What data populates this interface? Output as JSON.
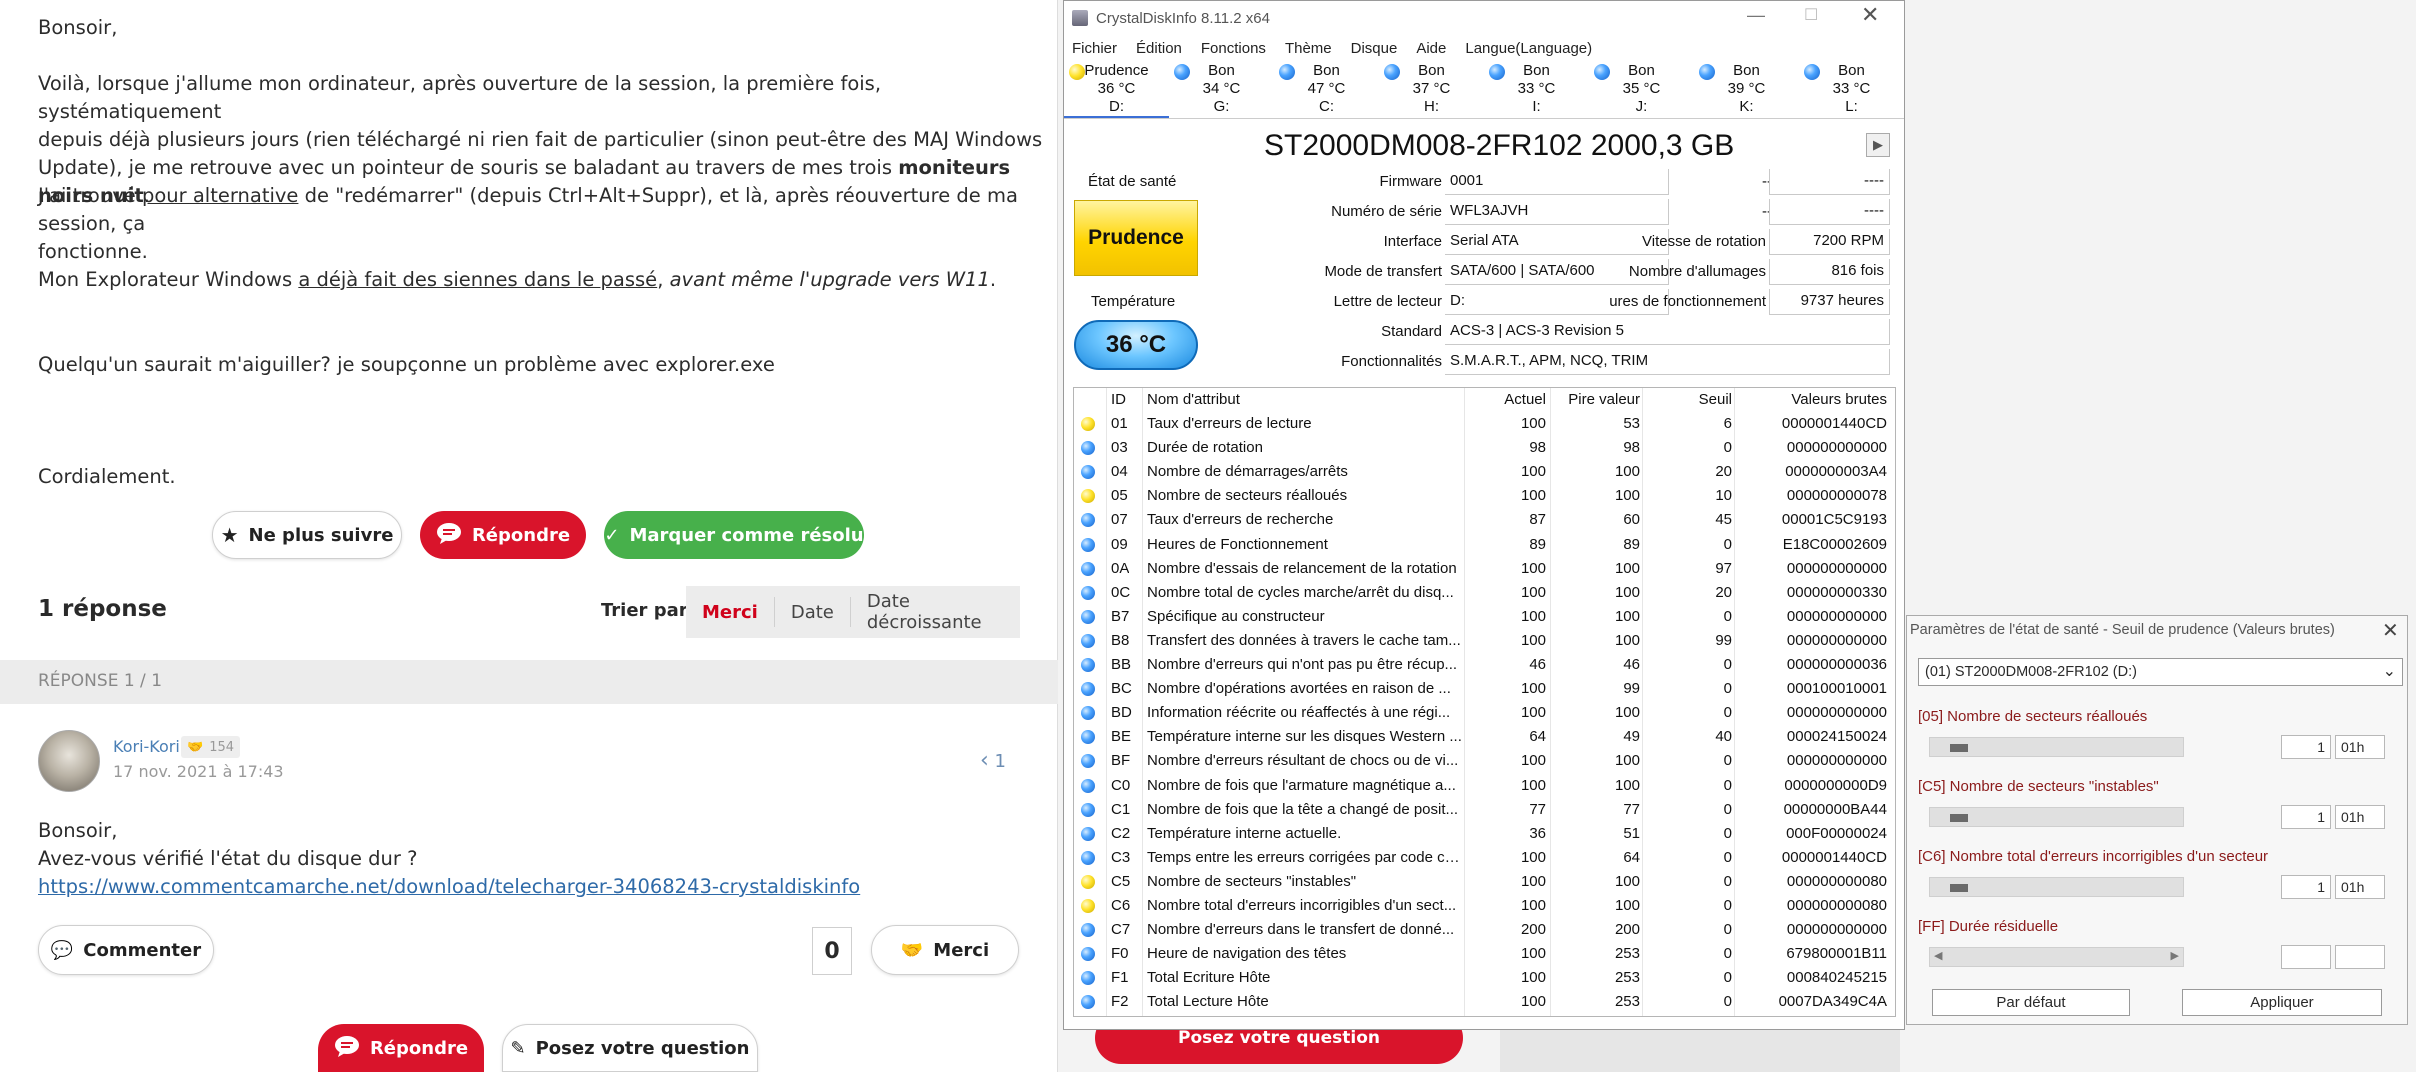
{
  "post": {
    "greeting": "Bonsoir,",
    "p1_a": "Voilà, lorsque j'allume mon ordinateur, après ouverture de la session, la première fois, systématiquement",
    "p1_b": "depuis déjà plusieurs jours (rien téléchargé ni rien fait de particulier (sinon peut-être des MAJ Windows",
    "p1_c": "Update), je me retrouve avec un pointeur de souris se baladant au travers de mes trois ",
    "p1_bold": "moniteurs noirs nuit",
    "p1_end": ".",
    "p2_a": "J'ai trouvé ",
    "p2_link": "pour alternative",
    "p2_b": " de \"redémarrer\" (depuis Ctrl+Alt+Suppr), et là, après réouverture de ma session, ça",
    "p2_c": "fonctionne.",
    "p3_a": "Mon Explorateur Windows ",
    "p3_link": "a déjà fait des siennes dans le passé",
    "p3_b": ", ",
    "p3_italic": "avant même l'upgrade vers W11",
    "p3_c": ".",
    "p4": "Quelqu'un saurait m'aiguiller? je soupçonne un problème avec explorer.exe",
    "sign": "Cordialement."
  },
  "actions": {
    "unfollow": "Ne plus suivre",
    "reply": "Répondre",
    "resolve": "Marquer comme résolu"
  },
  "answers": {
    "count": "1 réponse",
    "sort_label": "Trier par",
    "sort_options": [
      "Merci",
      "Date",
      "Date décroissante"
    ],
    "reply_header": "RÉPONSE 1 / 1",
    "author": "Kori-Kori",
    "author_score": "154",
    "date": "17 nov. 2021 à 17:43",
    "nav": "1",
    "body_1": "Bonsoir,",
    "body_2": "Avez-vous vérifié l'état du disque dur ?",
    "link": "https://www.commentcamarche.net/download/telecharger-34068243-crystaldiskinfo",
    "comment_btn": "Commenter",
    "thanks_count": "0",
    "thanks_btn": "Merci",
    "bottom_reply": "Répondre",
    "bottom_ask": "Posez votre question",
    "peek_btn": "Posez votre question"
  },
  "cdi": {
    "title": "CrystalDiskInfo 8.11.2 x64",
    "menu": [
      "Fichier",
      "Édition",
      "Fonctions",
      "Thème",
      "Disque",
      "Aide",
      "Langue(Language)"
    ],
    "drives": [
      {
        "status": "Prudence",
        "temp": "36 °C",
        "letter": "D:",
        "color": "yellow"
      },
      {
        "status": "Bon",
        "temp": "34 °C",
        "letter": "G:",
        "color": "blue"
      },
      {
        "status": "Bon",
        "temp": "47 °C",
        "letter": "C:",
        "color": "blue"
      },
      {
        "status": "Bon",
        "temp": "37 °C",
        "letter": "H:",
        "color": "blue"
      },
      {
        "status": "Bon",
        "temp": "33 °C",
        "letter": "I:",
        "color": "blue"
      },
      {
        "status": "Bon",
        "temp": "35 °C",
        "letter": "J:",
        "color": "blue"
      },
      {
        "status": "Bon",
        "temp": "39 °C",
        "letter": "K:",
        "color": "blue"
      },
      {
        "status": "Bon",
        "temp": "33 °C",
        "letter": "L:",
        "color": "blue"
      }
    ],
    "disk_title": "ST2000DM008-2FR102 2000,3 GB",
    "health_label": "État de santé",
    "health_value": "Prudence",
    "temp_label": "Température",
    "temp_value": "36 °C",
    "labels": {
      "firmware": "Firmware",
      "serial": "Numéro de série",
      "interface": "Interface",
      "transfer": "Mode de transfert",
      "letter": "Lettre de lecteur",
      "standard": "Standard",
      "features": "Fonctionnalités",
      "rotation": "Vitesse de rotation",
      "power_count": "Nombre d'allumages",
      "power_hours": "ures de fonctionnement",
      "dash": "----"
    },
    "values": {
      "firmware": "0001",
      "serial": "WFL3AJVH",
      "interface": "Serial ATA",
      "transfer": "SATA/600 | SATA/600",
      "letter": "D:",
      "standard": "ACS-3 | ACS-3 Revision 5",
      "features": "S.M.A.R.T., APM, NCQ, TRIM",
      "rotation": "7200 RPM",
      "power_count": "816 fois",
      "power_hours": "9737 heures",
      "dash": "----"
    },
    "columns": [
      "ID",
      "Nom d'attribut",
      "Actuel",
      "Pire valeur",
      "Seuil",
      "Valeurs brutes"
    ],
    "attributes": [
      {
        "dot": "yellow",
        "id": "01",
        "name": "Taux d'erreurs de lecture",
        "cur": "100",
        "worst": "53",
        "thr": "6",
        "raw": "0000001440CD"
      },
      {
        "dot": "blue",
        "id": "03",
        "name": "Durée de rotation",
        "cur": "98",
        "worst": "98",
        "thr": "0",
        "raw": "000000000000"
      },
      {
        "dot": "blue",
        "id": "04",
        "name": "Nombre de démarrages/arrêts",
        "cur": "100",
        "worst": "100",
        "thr": "20",
        "raw": "0000000003A4"
      },
      {
        "dot": "yellow",
        "id": "05",
        "name": "Nombre de secteurs réalloués",
        "cur": "100",
        "worst": "100",
        "thr": "10",
        "raw": "000000000078"
      },
      {
        "dot": "blue",
        "id": "07",
        "name": "Taux d'erreurs de recherche",
        "cur": "87",
        "worst": "60",
        "thr": "45",
        "raw": "00001C5C9193"
      },
      {
        "dot": "blue",
        "id": "09",
        "name": "Heures de Fonctionnement",
        "cur": "89",
        "worst": "89",
        "thr": "0",
        "raw": "E18C00002609"
      },
      {
        "dot": "blue",
        "id": "0A",
        "name": "Nombre d'essais de relancement de la rotation",
        "cur": "100",
        "worst": "100",
        "thr": "97",
        "raw": "000000000000"
      },
      {
        "dot": "blue",
        "id": "0C",
        "name": "Nombre total de cycles marche/arrêt du disq...",
        "cur": "100",
        "worst": "100",
        "thr": "20",
        "raw": "000000000330"
      },
      {
        "dot": "blue",
        "id": "B7",
        "name": "Spécifique au constructeur",
        "cur": "100",
        "worst": "100",
        "thr": "0",
        "raw": "000000000000"
      },
      {
        "dot": "blue",
        "id": "B8",
        "name": "Transfert des données à travers le cache tam...",
        "cur": "100",
        "worst": "100",
        "thr": "99",
        "raw": "000000000000"
      },
      {
        "dot": "blue",
        "id": "BB",
        "name": "Nombre d'erreurs qui n'ont pas pu être récup...",
        "cur": "46",
        "worst": "46",
        "thr": "0",
        "raw": "000000000036"
      },
      {
        "dot": "blue",
        "id": "BC",
        "name": "Nombre d'opérations avortées en raison de ...",
        "cur": "100",
        "worst": "99",
        "thr": "0",
        "raw": "000100010001"
      },
      {
        "dot": "blue",
        "id": "BD",
        "name": "Information réécrite ou réaffectés à une régi...",
        "cur": "100",
        "worst": "100",
        "thr": "0",
        "raw": "000000000000"
      },
      {
        "dot": "blue",
        "id": "BE",
        "name": "Température interne sur les disques Western ...",
        "cur": "64",
        "worst": "49",
        "thr": "40",
        "raw": "000024150024"
      },
      {
        "dot": "blue",
        "id": "BF",
        "name": "Nombre d'erreurs résultant de chocs ou de vi...",
        "cur": "100",
        "worst": "100",
        "thr": "0",
        "raw": "000000000000"
      },
      {
        "dot": "blue",
        "id": "C0",
        "name": "Nombre de fois que l'armature magnétique a...",
        "cur": "100",
        "worst": "100",
        "thr": "0",
        "raw": "0000000000D9"
      },
      {
        "dot": "blue",
        "id": "C1",
        "name": "Nombre de fois que la tête a changé de posit...",
        "cur": "77",
        "worst": "77",
        "thr": "0",
        "raw": "00000000BA44"
      },
      {
        "dot": "blue",
        "id": "C2",
        "name": "Température interne actuelle.",
        "cur": "36",
        "worst": "51",
        "thr": "0",
        "raw": "000F00000024"
      },
      {
        "dot": "blue",
        "id": "C3",
        "name": "Temps entre les erreurs corrigées par code co...",
        "cur": "100",
        "worst": "64",
        "thr": "0",
        "raw": "0000001440CD"
      },
      {
        "dot": "yellow",
        "id": "C5",
        "name": "Nombre de secteurs \"instables\"",
        "cur": "100",
        "worst": "100",
        "thr": "0",
        "raw": "000000000080"
      },
      {
        "dot": "yellow",
        "id": "C6",
        "name": "Nombre total d'erreurs incorrigibles d'un sect...",
        "cur": "100",
        "worst": "100",
        "thr": "0",
        "raw": "000000000080"
      },
      {
        "dot": "blue",
        "id": "C7",
        "name": "Nombre d'erreurs dans le transfert de donné...",
        "cur": "200",
        "worst": "200",
        "thr": "0",
        "raw": "000000000000"
      },
      {
        "dot": "blue",
        "id": "F0",
        "name": "Heure de navigation des têtes",
        "cur": "100",
        "worst": "253",
        "thr": "0",
        "raw": "679800001B11"
      },
      {
        "dot": "blue",
        "id": "F1",
        "name": "Total Ecriture Hôte",
        "cur": "100",
        "worst": "253",
        "thr": "0",
        "raw": "000840245215"
      },
      {
        "dot": "blue",
        "id": "F2",
        "name": "Total Lecture Hôte",
        "cur": "100",
        "worst": "253",
        "thr": "0",
        "raw": "0007DA349C4A"
      }
    ]
  },
  "dialog": {
    "title": "Paramètres de l'état de santé - Seuil de prudence (Valeurs brutes)",
    "drive_select": "(01) ST2000DM008-2FR102  (D:)",
    "sections": [
      {
        "label": "[05] Nombre de secteurs réalloués",
        "value": "1",
        "unit": "01h"
      },
      {
        "label": "[C5] Nombre de secteurs \"instables\"",
        "value": "1",
        "unit": "01h"
      },
      {
        "label": "[C6] Nombre total d'erreurs incorrigibles d'un secteur",
        "value": "1",
        "unit": "01h"
      },
      {
        "label": "[FF] Durée résiduelle",
        "value": "",
        "unit": ""
      }
    ],
    "default_btn": "Par défaut",
    "apply_btn": "Appliquer"
  },
  "colors": {
    "red": "#d9142b",
    "green": "#47b04b",
    "blue_dot": "#2a7de0",
    "yellow_dot": "#f2d40c",
    "health_yellow": "#ffd400",
    "temp_blue": "#3fa9f5"
  }
}
